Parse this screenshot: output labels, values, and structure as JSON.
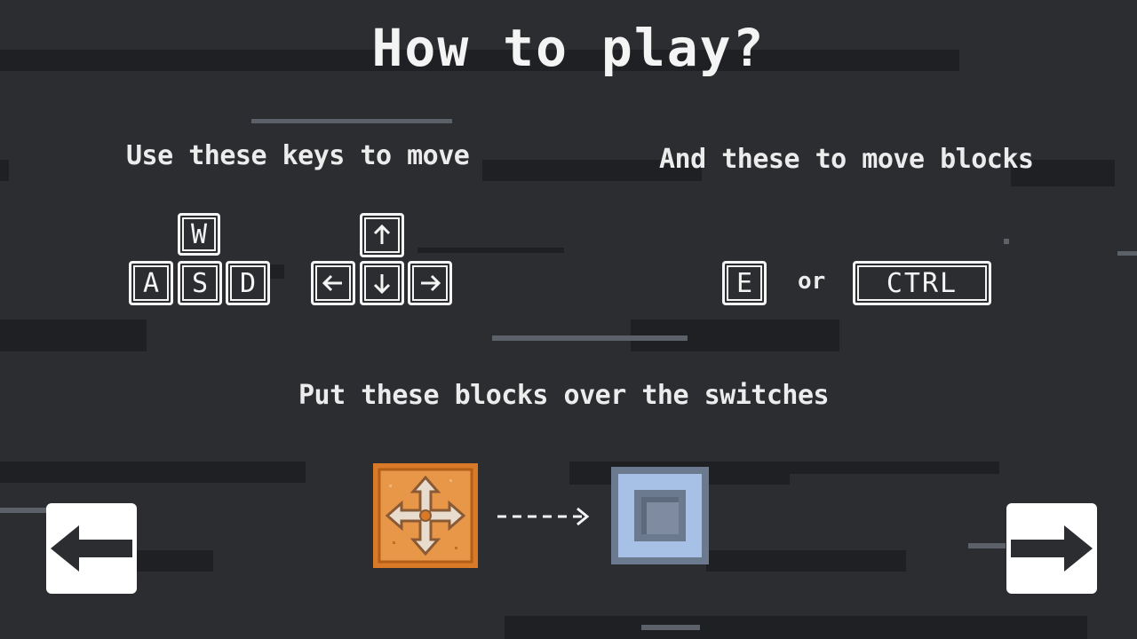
{
  "title": "How to play?",
  "move_heading": "Use these keys to move",
  "block_heading": "And these to move blocks",
  "blocks_heading": "Put these blocks over the switches",
  "wasd_keys": {
    "up": "W",
    "left": "A",
    "down": "S",
    "right": "D"
  },
  "arrow_keys": {
    "up": "arrow-up-icon",
    "left": "arrow-left-icon",
    "down": "arrow-down-icon",
    "right": "arrow-right-icon"
  },
  "block_keys": {
    "key1": "E",
    "or_label": "or",
    "key2": "CTRL"
  },
  "icons": {
    "prev": "arrow-left-icon",
    "next": "arrow-right-icon",
    "block": "move-cross-icon",
    "switch": "switch-icon",
    "dashed_arrow": "dashed-arrow-icon"
  },
  "colors": {
    "background": "#2b2d31",
    "block_orange": "#e0822e",
    "switch_blue": "#a7c1e6"
  }
}
